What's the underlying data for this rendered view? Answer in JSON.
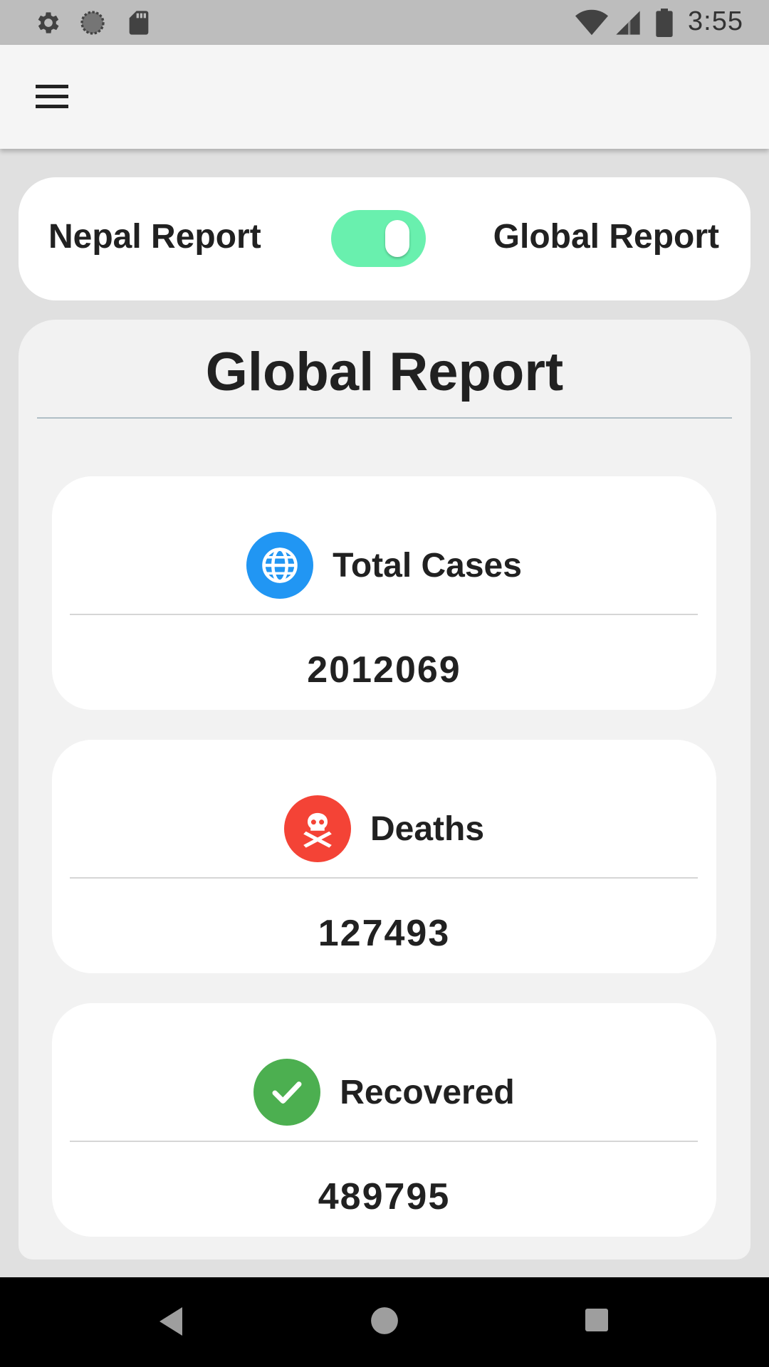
{
  "status_bar": {
    "time": "3:55",
    "icons": [
      "settings-icon",
      "sync-icon",
      "sd-card-icon",
      "wifi-icon",
      "signal-icon",
      "battery-icon"
    ]
  },
  "app_bar": {
    "menu_icon": "hamburger-menu-icon"
  },
  "report_toggle": {
    "left_label": "Nepal Report",
    "right_label": "Global Report",
    "state": "on",
    "accent_color": "#69f0ae"
  },
  "main": {
    "title": "Global Report",
    "stats": [
      {
        "label": "Total Cases",
        "value": "2012069",
        "icon": "globe-icon",
        "color": "#2196f3"
      },
      {
        "label": "Deaths",
        "value": "127493",
        "icon": "skull-crossbones-icon",
        "color": "#f44336"
      },
      {
        "label": "Recovered",
        "value": "489795",
        "icon": "check-icon",
        "color": "#4caf50"
      }
    ]
  },
  "nav_bar": {
    "buttons": [
      "back-icon",
      "home-icon",
      "recents-icon"
    ]
  }
}
